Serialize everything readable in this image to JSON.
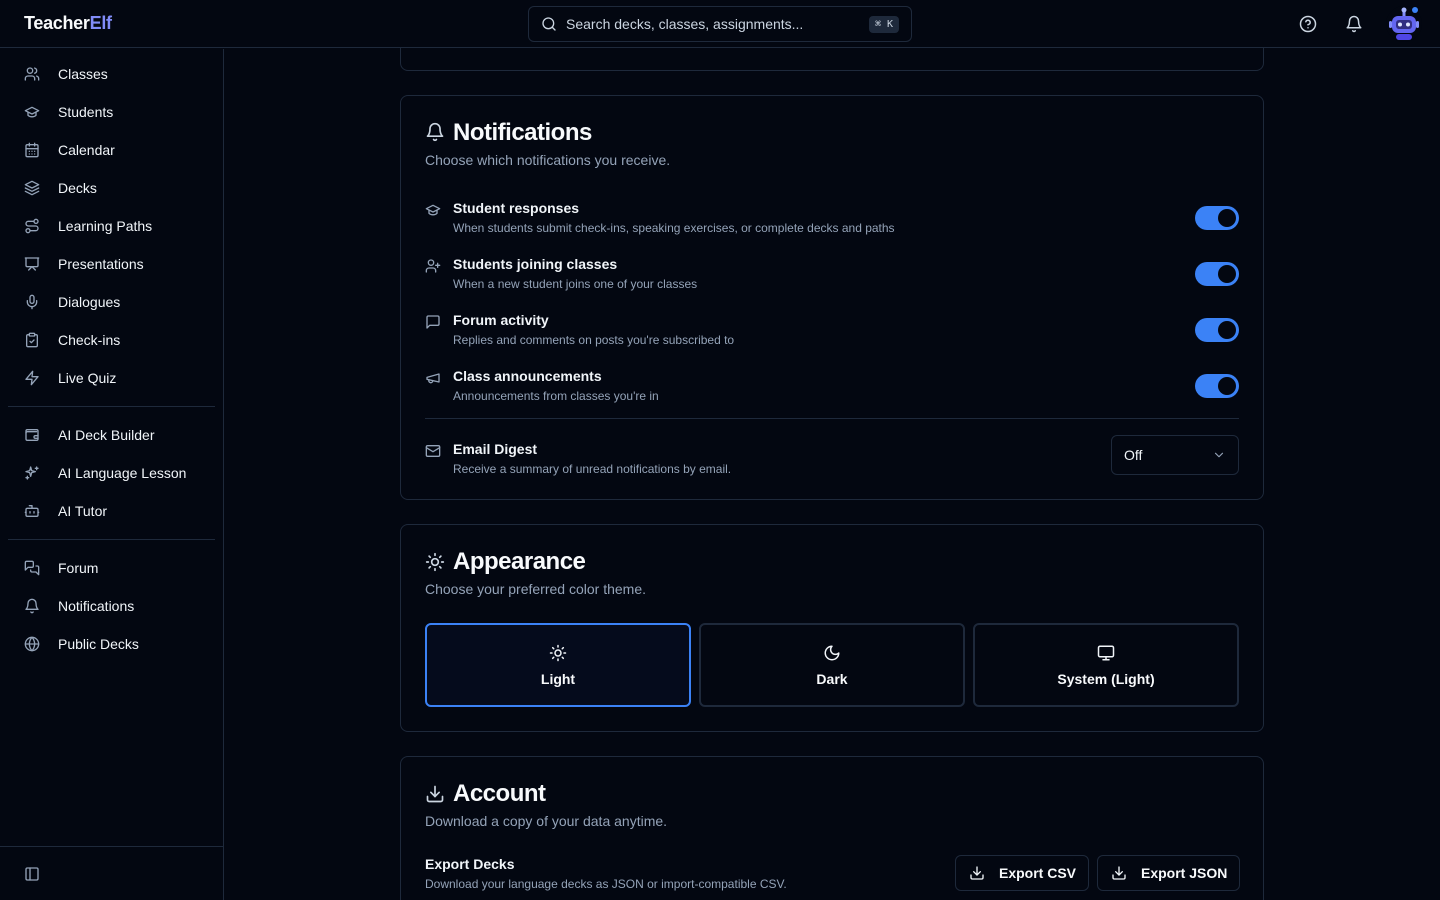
{
  "app": {
    "logo_main": "Teacher",
    "logo_accent": "Elf"
  },
  "search": {
    "placeholder": "Search decks, classes, assignments...",
    "shortcut": "⌘ K"
  },
  "sidebar": {
    "groups": [
      [
        {
          "label": "Classes",
          "icon": "users-icon"
        },
        {
          "label": "Students",
          "icon": "graduation-cap-icon"
        },
        {
          "label": "Calendar",
          "icon": "calendar-icon"
        },
        {
          "label": "Decks",
          "icon": "layers-icon"
        },
        {
          "label": "Learning Paths",
          "icon": "route-icon"
        },
        {
          "label": "Presentations",
          "icon": "presentation-icon"
        },
        {
          "label": "Dialogues",
          "icon": "microphone-icon"
        },
        {
          "label": "Check-ins",
          "icon": "clipboard-check-icon"
        },
        {
          "label": "Live Quiz",
          "icon": "zap-icon"
        }
      ],
      [
        {
          "label": "AI Deck Builder",
          "icon": "wallet-cards-icon"
        },
        {
          "label": "AI Language Lesson",
          "icon": "sparkles-icon"
        },
        {
          "label": "AI Tutor",
          "icon": "bot-icon"
        }
      ],
      [
        {
          "label": "Forum",
          "icon": "messages-icon"
        },
        {
          "label": "Notifications",
          "icon": "bell-icon"
        },
        {
          "label": "Public Decks",
          "icon": "globe-icon"
        }
      ]
    ]
  },
  "notifications": {
    "title": "Notifications",
    "description": "Choose which notifications you receive.",
    "items": [
      {
        "title": "Student responses",
        "description": "When students submit check-ins, speaking exercises, or complete decks and paths",
        "enabled": true,
        "icon": "graduation-cap-icon"
      },
      {
        "title": "Students joining classes",
        "description": "When a new student joins one of your classes",
        "enabled": true,
        "icon": "user-plus-icon"
      },
      {
        "title": "Forum activity",
        "description": "Replies and comments on posts you're subscribed to",
        "enabled": true,
        "icon": "message-square-icon"
      },
      {
        "title": "Class announcements",
        "description": "Announcements from classes you're in",
        "enabled": true,
        "icon": "megaphone-icon"
      }
    ],
    "email_digest": {
      "title": "Email Digest",
      "description": "Receive a summary of unread notifications by email.",
      "value": "Off"
    }
  },
  "appearance": {
    "title": "Appearance",
    "description": "Choose your preferred color theme.",
    "options": [
      {
        "label": "Light",
        "icon": "sun-icon",
        "selected": true
      },
      {
        "label": "Dark",
        "icon": "moon-icon",
        "selected": false
      },
      {
        "label": "System (Light)",
        "icon": "monitor-icon",
        "selected": false
      }
    ]
  },
  "account": {
    "title": "Account",
    "description": "Download a copy of your data anytime.",
    "export_title": "Export Decks",
    "export_description": "Download your language decks as JSON or import-compatible CSV.",
    "export_csv_label": "Export CSV",
    "export_json_label": "Export JSON"
  },
  "colors": {
    "background": "#030711",
    "accent": "#3b82f6",
    "border": "#1e293b",
    "logo_accent": "#818cf8"
  }
}
